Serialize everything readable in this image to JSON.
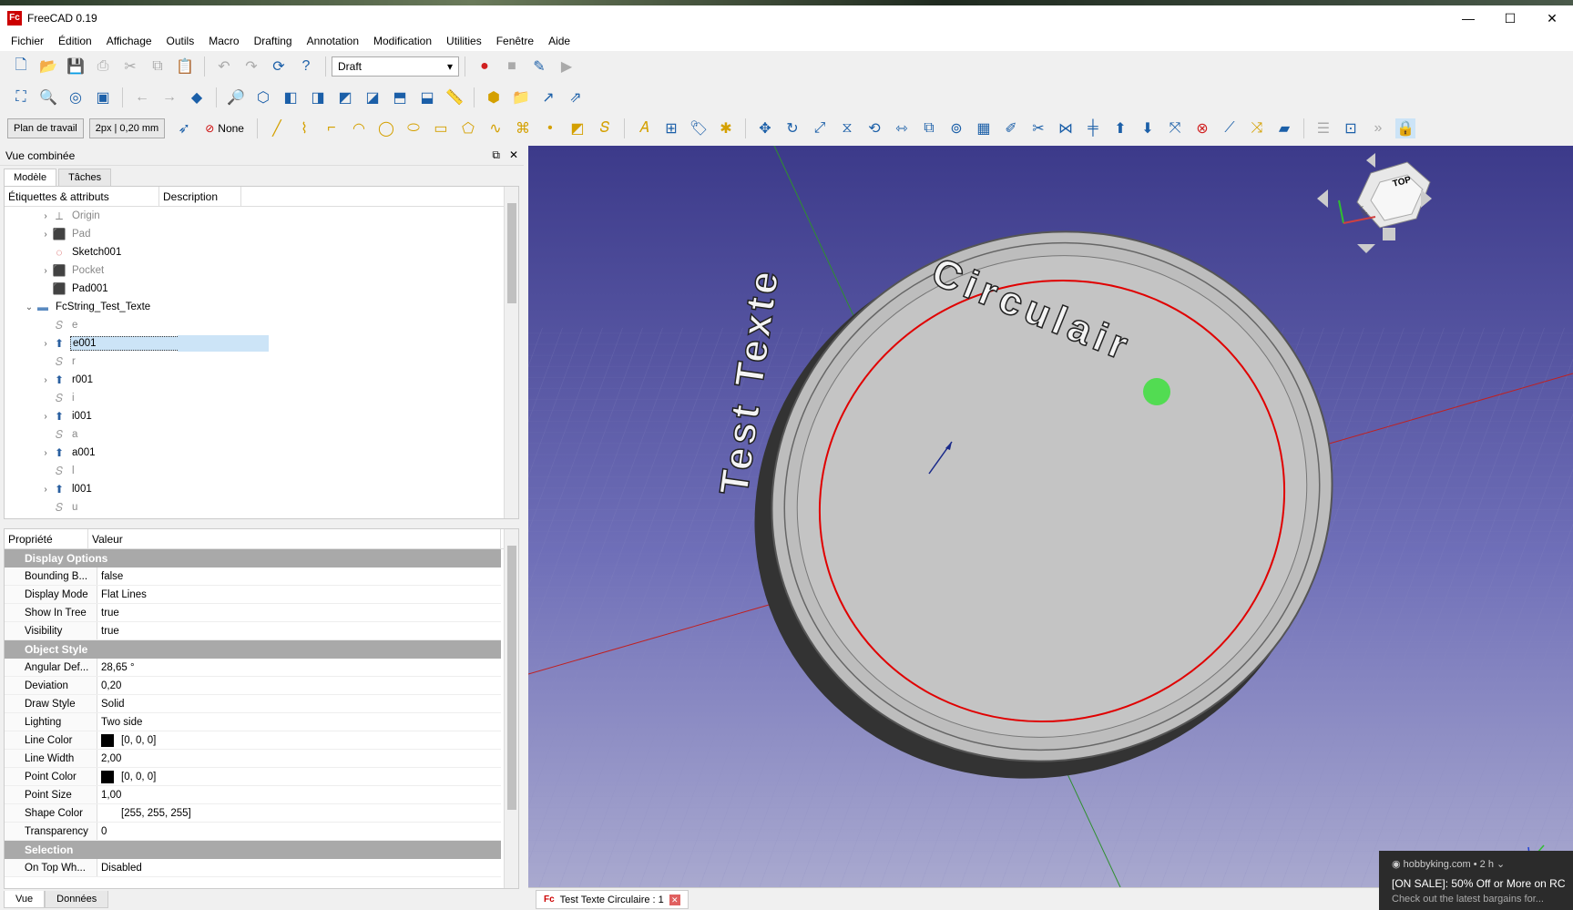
{
  "window": {
    "title": "FreeCAD 0.19",
    "logo": "Fc"
  },
  "menu": [
    "Fichier",
    "Édition",
    "Affichage",
    "Outils",
    "Macro",
    "Drafting",
    "Annotation",
    "Modification",
    "Utilities",
    "Fenêtre",
    "Aide"
  ],
  "toolbar": {
    "workbench": "Draft",
    "working_plane": "Plan de travail",
    "line_style": "2px | 0,20 mm",
    "snap_none": "None"
  },
  "combo_view": {
    "title": "Vue combinée",
    "tabs": [
      "Modèle",
      "Tâches"
    ],
    "tree_headers": [
      "Étiquettes & attributs",
      "Description"
    ],
    "tree": [
      {
        "label": "Origin",
        "icon": "origin-icon",
        "indent": 1,
        "expander": true,
        "dim": true
      },
      {
        "label": "Pad",
        "icon": "pad-icon",
        "indent": 1,
        "expander": true,
        "dim": true
      },
      {
        "label": "Sketch001",
        "icon": "sketch-icon",
        "indent": 1,
        "expander": false,
        "dim": false
      },
      {
        "label": "Pocket",
        "icon": "pocket-icon",
        "indent": 1,
        "expander": true,
        "dim": true
      },
      {
        "label": "Pad001",
        "icon": "pad-icon",
        "indent": 1,
        "expander": false,
        "dim": false
      },
      {
        "label": "FcString_Test_Texte",
        "icon": "folder-icon",
        "indent": 0,
        "expander": true,
        "expanded": true,
        "dim": false
      },
      {
        "label": "e",
        "icon": "shapestring-icon",
        "indent": 1,
        "expander": false,
        "dim": true
      },
      {
        "label": "e001",
        "icon": "extrude-icon",
        "indent": 1,
        "expander": true,
        "dim": false,
        "selected": true
      },
      {
        "label": "r",
        "icon": "shapestring-icon",
        "indent": 1,
        "expander": false,
        "dim": true
      },
      {
        "label": "r001",
        "icon": "extrude-icon",
        "indent": 1,
        "expander": true,
        "dim": false
      },
      {
        "label": "i",
        "icon": "shapestring-icon",
        "indent": 1,
        "expander": false,
        "dim": true
      },
      {
        "label": "i001",
        "icon": "extrude-icon",
        "indent": 1,
        "expander": true,
        "dim": false
      },
      {
        "label": "a",
        "icon": "shapestring-icon",
        "indent": 1,
        "expander": false,
        "dim": true
      },
      {
        "label": "a001",
        "icon": "extrude-icon",
        "indent": 1,
        "expander": true,
        "dim": false
      },
      {
        "label": "l",
        "icon": "shapestring-icon",
        "indent": 1,
        "expander": false,
        "dim": true
      },
      {
        "label": "l001",
        "icon": "extrude-icon",
        "indent": 1,
        "expander": true,
        "dim": false
      },
      {
        "label": "u",
        "icon": "shapestring-icon",
        "indent": 1,
        "expander": false,
        "dim": true
      }
    ],
    "prop_headers": [
      "Propriété",
      "Valeur"
    ],
    "properties": [
      {
        "group": "Display Options"
      },
      {
        "name": "Bounding B...",
        "value": "false"
      },
      {
        "name": "Display Mode",
        "value": "Flat Lines"
      },
      {
        "name": "Show In Tree",
        "value": "true"
      },
      {
        "name": "Visibility",
        "value": "true"
      },
      {
        "group": "Object Style"
      },
      {
        "name": "Angular Def...",
        "value": "28,65 °"
      },
      {
        "name": "Deviation",
        "value": "0,20"
      },
      {
        "name": "Draw Style",
        "value": "Solid"
      },
      {
        "name": "Lighting",
        "value": "Two side"
      },
      {
        "name": "Line Color",
        "value": "[0, 0, 0]",
        "swatch": "#000000"
      },
      {
        "name": "Line Width",
        "value": "2,00"
      },
      {
        "name": "Point Color",
        "value": "[0, 0, 0]",
        "swatch": "#000000"
      },
      {
        "name": "Point Size",
        "value": "1,00"
      },
      {
        "name": "Shape Color",
        "value": "[255, 255, 255]",
        "swatch": "#ffffff"
      },
      {
        "name": "Transparency",
        "value": "0"
      },
      {
        "group": "Selection"
      },
      {
        "name": "On Top Wh...",
        "value": "Disabled"
      }
    ],
    "bottom_tabs": [
      "Vue",
      "Données"
    ]
  },
  "viewport": {
    "text_left": "Test Texte",
    "text_right": "Circulair",
    "navcube_face": "TOP",
    "navcube_left": "Left"
  },
  "document_tab": "Test Texte Circulaire : 1",
  "notification": {
    "source": "hobbyking.com",
    "age": "• 2 h ⌄",
    "title": "[ON SALE]: 50% Off or More on RC",
    "body": "Check out the latest bargains for..."
  },
  "colors": {
    "selection": "#cce4f7",
    "group_header": "#a9a9a9",
    "circle": "#e00000"
  }
}
